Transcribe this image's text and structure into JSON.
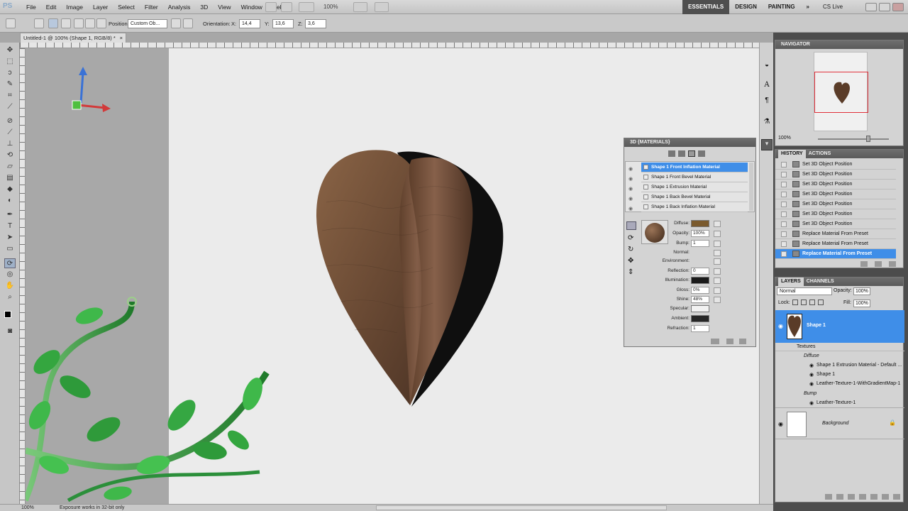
{
  "app": {
    "logo": "PS"
  },
  "menu": [
    "File",
    "Edit",
    "Image",
    "Layer",
    "Select",
    "Filter",
    "Analysis",
    "3D",
    "View",
    "Window",
    "Help"
  ],
  "zoom": "100%",
  "workspaces": {
    "essentials": "ESSENTIALS",
    "design": "DESIGN",
    "painting": "PAINTING",
    "more": "»"
  },
  "cslive": "CS Live",
  "options": {
    "position_label": "Position:",
    "position_value": "Custom Ob...",
    "orientation_label": "Orientation:",
    "x_label": "X:",
    "x_value": "14,4",
    "y_label": "Y:",
    "y_value": "13,6",
    "z_label": "Z:",
    "z_value": "3,6"
  },
  "document": {
    "tab_title": "Untitled-1 @ 100% (Shape 1, RGB/8) *",
    "close": "×"
  },
  "status": {
    "zoom": "100%",
    "message": "Exposure works in 32-bit only"
  },
  "navigator": {
    "title": "NAVIGATOR",
    "zoom": "100%"
  },
  "history": {
    "tabs": [
      "HISTORY",
      "ACTIONS"
    ],
    "items": [
      "Set 3D Object Position",
      "Set 3D Object Position",
      "Set 3D Object Position",
      "Set 3D Object Position",
      "Set 3D Object Position",
      "Set 3D Object Position",
      "Set 3D Object Position",
      "Replace Material From Preset",
      "Replace Material From Preset",
      "Replace Material From Preset"
    ],
    "selected_index": 9
  },
  "layers": {
    "tabs": [
      "LAYERS",
      "CHANNELS"
    ],
    "blend_mode": "Normal",
    "opacity_label": "Opacity:",
    "opacity_value": "100%",
    "lock_label": "Lock:",
    "fill_label": "Fill:",
    "fill_value": "100%",
    "shape_layer": "Shape 1",
    "textures_label": "Textures",
    "diffuse_label": "Diffuse",
    "diffuse_items": [
      "Shape 1 Extrusion Material - Default ...",
      "Shape 1",
      "Leather-Texture-1-WithGradientMap-1"
    ],
    "bump_label": "Bump",
    "bump_items": [
      "Leather-Texture-1"
    ],
    "background_layer": "Background"
  },
  "materials_panel": {
    "title": "3D {MATERIALS}",
    "materials": [
      "Shape 1 Front Inflation Material",
      "Shape 1 Front Bevel Material",
      "Shape 1 Extrusion Material",
      "Shape 1 Back Bevel Material",
      "Shape 1 Back Inflation Material"
    ],
    "selected_index": 0,
    "properties": {
      "diffuse": {
        "label": "Diffuse:",
        "color": "#7a5a2e"
      },
      "opacity": {
        "label": "Opacity:",
        "value": "100%"
      },
      "bump": {
        "label": "Bump:",
        "value": "1"
      },
      "normal": {
        "label": "Normal:"
      },
      "environment": {
        "label": "Environment:"
      },
      "reflection": {
        "label": "Reflection:",
        "value": "0"
      },
      "illumination": {
        "label": "Illumination:",
        "color": "#1a1a1a"
      },
      "gloss": {
        "label": "Gloss:",
        "value": "0%"
      },
      "shine": {
        "label": "Shine:",
        "value": "48%"
      },
      "specular": {
        "label": "Specular:",
        "color": "#f2f2f2"
      },
      "ambient": {
        "label": "Ambient:",
        "color": "#262626"
      },
      "refraction": {
        "label": "Refraction:",
        "value": "1"
      }
    }
  },
  "colors": {
    "selection": "#3f8ee8",
    "leather": "#6b4a33",
    "leaf": "#2f9a3a"
  }
}
